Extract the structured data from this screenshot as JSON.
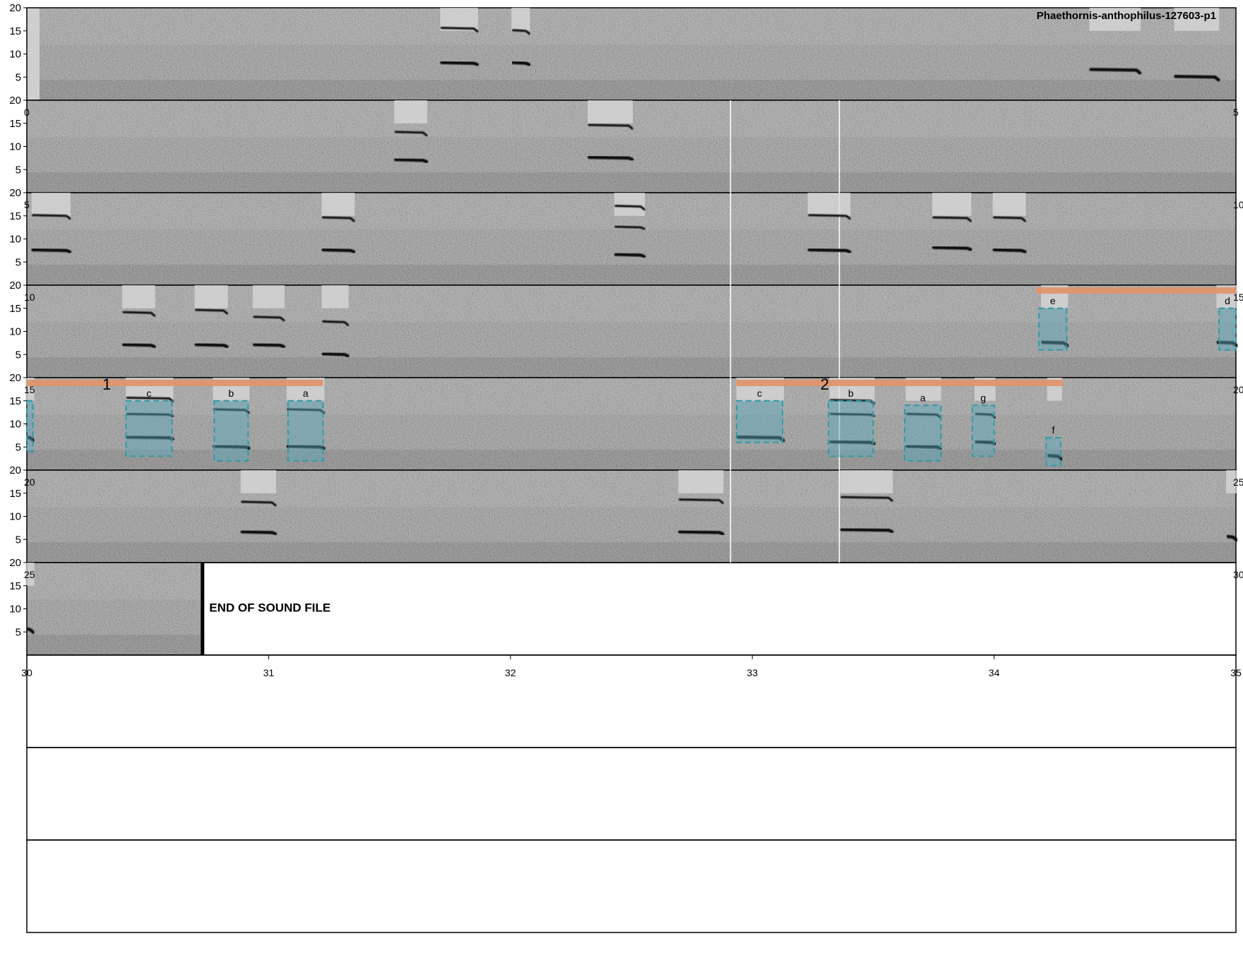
{
  "chart_data": {
    "type": "spectrogram",
    "title": "Phaethornis-anthophilus-127603-p1",
    "end_label": "END OF SOUND FILE",
    "ylim": [
      0,
      20
    ],
    "y_ticks": [
      5,
      10,
      15,
      20
    ],
    "x_ticks": [
      30,
      31,
      32,
      33,
      34,
      35
    ],
    "x_tick_labels": [
      "30",
      "31",
      "32",
      "33",
      "34",
      "35"
    ],
    "rows_total": 10,
    "rows_with_sound": 7,
    "row_duration_s": 5,
    "end_of_file_row": 7,
    "end_of_file_time_fraction": 0.145,
    "divider_fractions": [
      0.582,
      0.672
    ],
    "divider_rows": [
      2,
      3,
      4,
      5,
      6
    ],
    "colors": {
      "selection_fill": "#5aaabe",
      "selection_stroke": "#2e9aa8",
      "group_bar": "#e0956a"
    },
    "row_edge_labels": [
      {
        "row": 2,
        "left": "0",
        "right": "5"
      },
      {
        "row": 3,
        "left": "5",
        "right": "10"
      },
      {
        "row": 4,
        "left": "10",
        "right": "15"
      },
      {
        "row": 5,
        "left": "15",
        "right": "20"
      },
      {
        "row": 6,
        "left": "20",
        "right": "25"
      },
      {
        "row": 7,
        "left": "25",
        "right": "30"
      }
    ],
    "calls": [
      {
        "row": 1,
        "t0": 0.343,
        "t1": 0.372,
        "f": [
          8,
          15.5
        ]
      },
      {
        "row": 1,
        "t0": 0.402,
        "t1": 0.415,
        "f": [
          8,
          15
        ]
      },
      {
        "row": 1,
        "t0": 0.88,
        "t1": 0.92,
        "f": [
          6.5
        ]
      },
      {
        "row": 1,
        "t0": 0.95,
        "t1": 0.985,
        "f": [
          5
        ]
      },
      {
        "row": 2,
        "t0": 0.305,
        "t1": 0.33,
        "f": [
          7,
          13
        ]
      },
      {
        "row": 2,
        "t0": 0.465,
        "t1": 0.5,
        "f": [
          7.5,
          14.5
        ]
      },
      {
        "row": 3,
        "t0": 0.005,
        "t1": 0.035,
        "f": [
          7.5,
          15
        ]
      },
      {
        "row": 3,
        "t0": 0.245,
        "t1": 0.27,
        "f": [
          7.5,
          14.5
        ]
      },
      {
        "row": 3,
        "t0": 0.487,
        "t1": 0.51,
        "f": [
          6.5,
          12.5,
          17
        ]
      },
      {
        "row": 3,
        "t0": 0.647,
        "t1": 0.68,
        "f": [
          7.5,
          15
        ]
      },
      {
        "row": 3,
        "t0": 0.75,
        "t1": 0.78,
        "f": [
          8,
          14.5
        ]
      },
      {
        "row": 3,
        "t0": 0.8,
        "t1": 0.825,
        "f": [
          7.5,
          14.5
        ]
      },
      {
        "row": 4,
        "t0": 0.08,
        "t1": 0.105,
        "f": [
          7,
          14
        ]
      },
      {
        "row": 4,
        "t0": 0.14,
        "t1": 0.165,
        "f": [
          7,
          14.5
        ]
      },
      {
        "row": 4,
        "t0": 0.188,
        "t1": 0.212,
        "f": [
          7,
          13
        ]
      },
      {
        "row": 4,
        "t0": 0.245,
        "t1": 0.265,
        "f": [
          5,
          12
        ]
      },
      {
        "row": 4,
        "t0": 0.84,
        "t1": 0.86,
        "f": [
          7.5
        ]
      },
      {
        "row": 4,
        "t0": 0.985,
        "t1": 1.0,
        "f": [
          7.5
        ]
      },
      {
        "row": 5,
        "t0": 0.0,
        "t1": 0.005,
        "f": [
          7
        ]
      },
      {
        "row": 5,
        "t0": 0.083,
        "t1": 0.12,
        "f": [
          7,
          12,
          15.5
        ]
      },
      {
        "row": 5,
        "t0": 0.155,
        "t1": 0.183,
        "f": [
          5,
          13
        ]
      },
      {
        "row": 5,
        "t0": 0.216,
        "t1": 0.245,
        "f": [
          5,
          13
        ]
      },
      {
        "row": 5,
        "t0": 0.588,
        "t1": 0.625,
        "f": [
          7
        ]
      },
      {
        "row": 5,
        "t0": 0.665,
        "t1": 0.7,
        "f": [
          6,
          12,
          15
        ]
      },
      {
        "row": 5,
        "t0": 0.728,
        "t1": 0.755,
        "f": [
          5,
          12
        ]
      },
      {
        "row": 5,
        "t0": 0.785,
        "t1": 0.8,
        "f": [
          6,
          12
        ]
      },
      {
        "row": 5,
        "t0": 0.845,
        "t1": 0.855,
        "f": [
          3
        ]
      },
      {
        "row": 6,
        "t0": 0.178,
        "t1": 0.205,
        "f": [
          6.5,
          13
        ]
      },
      {
        "row": 6,
        "t0": 0.54,
        "t1": 0.575,
        "f": [
          6.5,
          13.5
        ]
      },
      {
        "row": 6,
        "t0": 0.674,
        "t1": 0.715,
        "f": [
          7,
          14
        ]
      },
      {
        "row": 6,
        "t0": 0.993,
        "t1": 1.0,
        "f": [
          5.5
        ]
      },
      {
        "row": 7,
        "t0": 0.0,
        "t1": 0.005,
        "f": [
          5.5
        ]
      }
    ],
    "selections": [
      {
        "row": 4,
        "t0": 0.837,
        "t1": 0.86,
        "f": [
          6,
          15
        ],
        "label": "e"
      },
      {
        "row": 4,
        "t0": 0.986,
        "t1": 1.0,
        "f": [
          6,
          15
        ],
        "label": "d"
      },
      {
        "row": 5,
        "t0": 0.0,
        "t1": 0.005,
        "f": [
          4,
          15
        ],
        "label": ""
      },
      {
        "row": 5,
        "t0": 0.082,
        "t1": 0.12,
        "f": [
          3,
          15
        ],
        "label": "c"
      },
      {
        "row": 5,
        "t0": 0.155,
        "t1": 0.183,
        "f": [
          2,
          15
        ],
        "label": "b"
      },
      {
        "row": 5,
        "t0": 0.216,
        "t1": 0.245,
        "f": [
          2,
          15
        ],
        "label": "a"
      },
      {
        "row": 5,
        "t0": 0.587,
        "t1": 0.625,
        "f": [
          6,
          15
        ],
        "label": "c"
      },
      {
        "row": 5,
        "t0": 0.663,
        "t1": 0.7,
        "f": [
          3,
          15
        ],
        "label": "b"
      },
      {
        "row": 5,
        "t0": 0.726,
        "t1": 0.756,
        "f": [
          2,
          14
        ],
        "label": "a"
      },
      {
        "row": 5,
        "t0": 0.782,
        "t1": 0.8,
        "f": [
          3,
          14
        ],
        "label": "g"
      },
      {
        "row": 5,
        "t0": 0.843,
        "t1": 0.855,
        "f": [
          1,
          7
        ],
        "label": "f"
      }
    ],
    "groups": [
      {
        "row": 4,
        "t0": 0.835,
        "t1": 1.0,
        "label": ""
      },
      {
        "row": 5,
        "t0": 0.0,
        "t1": 0.245,
        "label": "1"
      },
      {
        "row": 5,
        "t0": 0.587,
        "t1": 0.857,
        "label": "2"
      }
    ]
  }
}
